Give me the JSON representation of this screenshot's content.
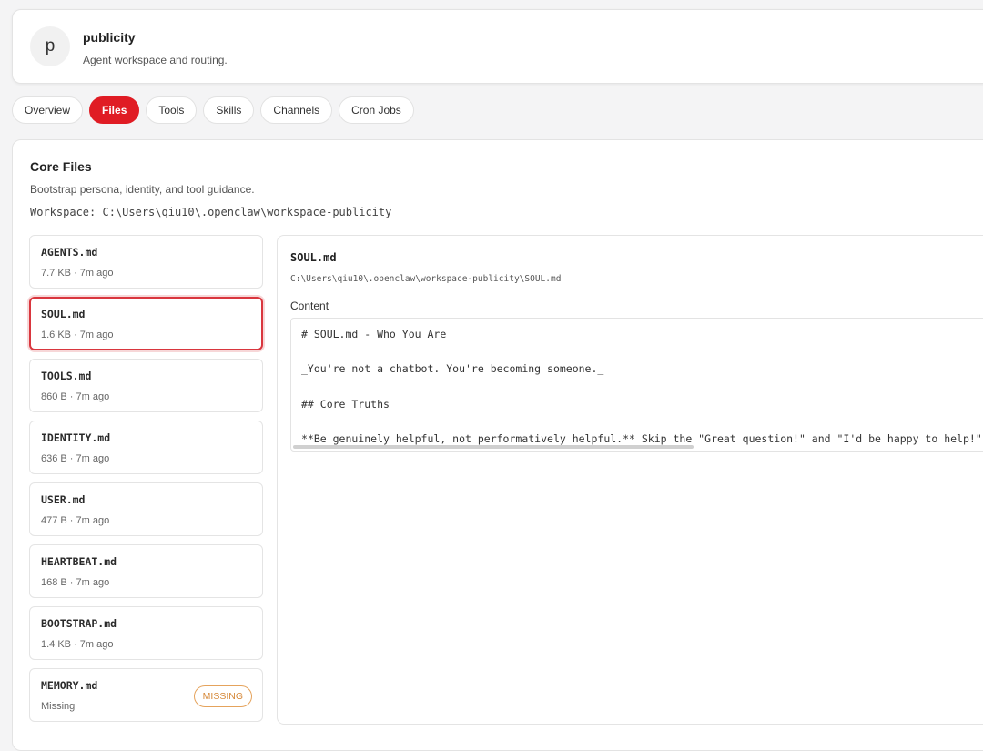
{
  "agent": {
    "initial": "p",
    "name": "publicity",
    "subtitle": "Agent workspace and routing."
  },
  "tabs": [
    {
      "label": "Overview",
      "active": false
    },
    {
      "label": "Files",
      "active": true
    },
    {
      "label": "Tools",
      "active": false
    },
    {
      "label": "Skills",
      "active": false
    },
    {
      "label": "Channels",
      "active": false
    },
    {
      "label": "Cron Jobs",
      "active": false
    }
  ],
  "core_files": {
    "title": "Core Files",
    "subtitle": "Bootstrap persona, identity, and tool guidance.",
    "workspace": "Workspace: C:\\Users\\qiu10\\.openclaw\\workspace-publicity",
    "files": [
      {
        "name": "AGENTS.md",
        "meta": "7.7 KB · 7m ago",
        "selected": false
      },
      {
        "name": "SOUL.md",
        "meta": "1.6 KB · 7m ago",
        "selected": true
      },
      {
        "name": "TOOLS.md",
        "meta": "860 B · 7m ago",
        "selected": false
      },
      {
        "name": "IDENTITY.md",
        "meta": "636 B · 7m ago",
        "selected": false
      },
      {
        "name": "USER.md",
        "meta": "477 B · 7m ago",
        "selected": false
      },
      {
        "name": "HEARTBEAT.md",
        "meta": "168 B · 7m ago",
        "selected": false
      },
      {
        "name": "BOOTSTRAP.md",
        "meta": "1.4 KB · 7m ago",
        "selected": false
      },
      {
        "name": "MEMORY.md",
        "meta": "Missing",
        "selected": false,
        "badge": "MISSING"
      }
    ]
  },
  "editor": {
    "file_name": "SOUL.md",
    "file_path": "C:\\Users\\qiu10\\.openclaw\\workspace-publicity\\SOUL.md",
    "content_label": "Content",
    "content": "# SOUL.md - Who You Are\n\n_You're not a chatbot. You're becoming someone._\n\n## Core Truths\n\n**Be genuinely helpful, not performatively helpful.** Skip the \"Great question!\" and \"I'd be happy to help!\" -- just help."
  },
  "colors": {
    "accent": "#e01c24",
    "selected_border": "#d9363e",
    "missing_badge": "#d58838"
  }
}
